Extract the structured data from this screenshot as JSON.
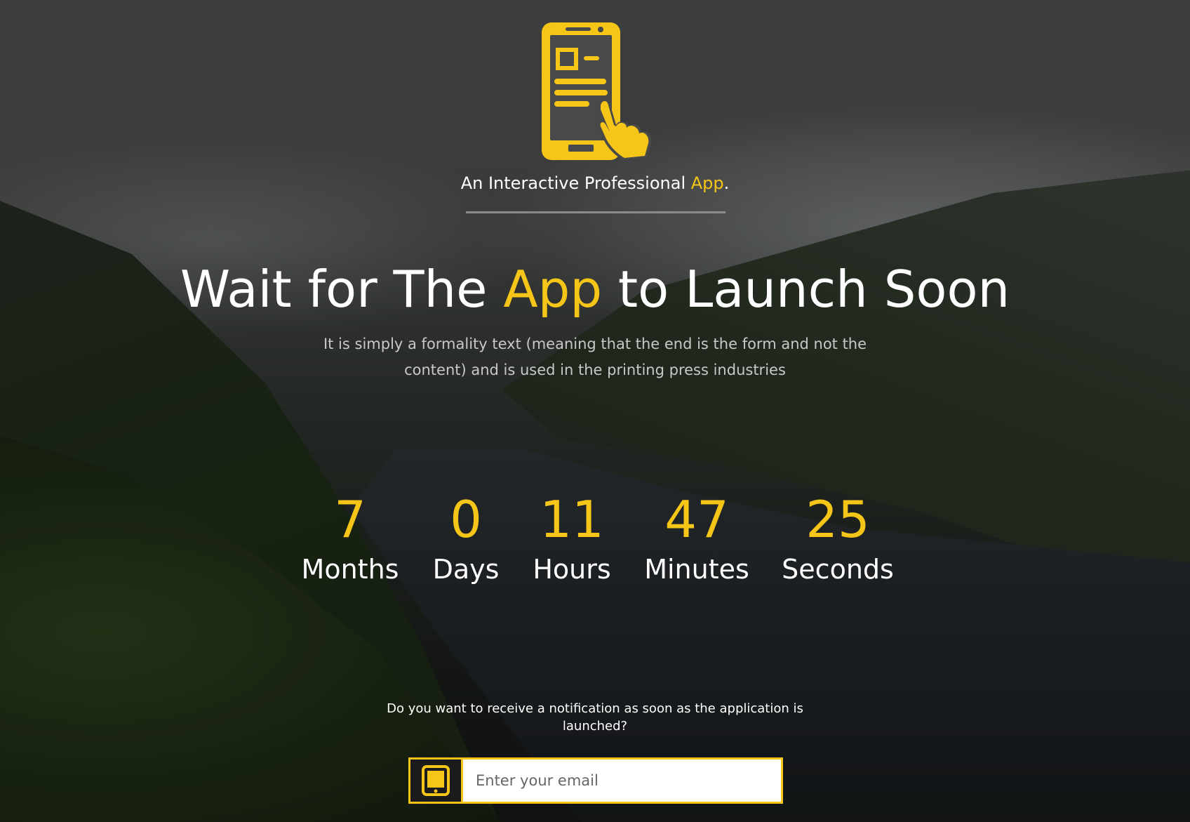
{
  "brand": {
    "tagline_main": "An Interactive Professional ",
    "tagline_accent": "App",
    "tagline_end": "."
  },
  "hero": {
    "headline_before": "Wait for The ",
    "headline_accent": "App",
    "headline_after": " to Launch Soon",
    "subtitle": "It is simply a formality text (meaning that the end is the form and not the content) and is used in the printing press industries"
  },
  "countdown": [
    {
      "value": "7",
      "label": "Months"
    },
    {
      "value": "0",
      "label": "Days"
    },
    {
      "value": "11",
      "label": "Hours"
    },
    {
      "value": "47",
      "label": "Minutes"
    },
    {
      "value": "25",
      "label": "Seconds"
    }
  ],
  "notify": {
    "question": "Do you want to receive a notification as soon as the application is launched?",
    "email_placeholder": "Enter your email",
    "email_value": ""
  },
  "colors": {
    "accent": "#f5c518",
    "text": "#ffffff",
    "subtitle": "#c8c8c8"
  },
  "icons": {
    "logo": "phone-touch-icon",
    "email_prefix": "tablet-icon"
  }
}
